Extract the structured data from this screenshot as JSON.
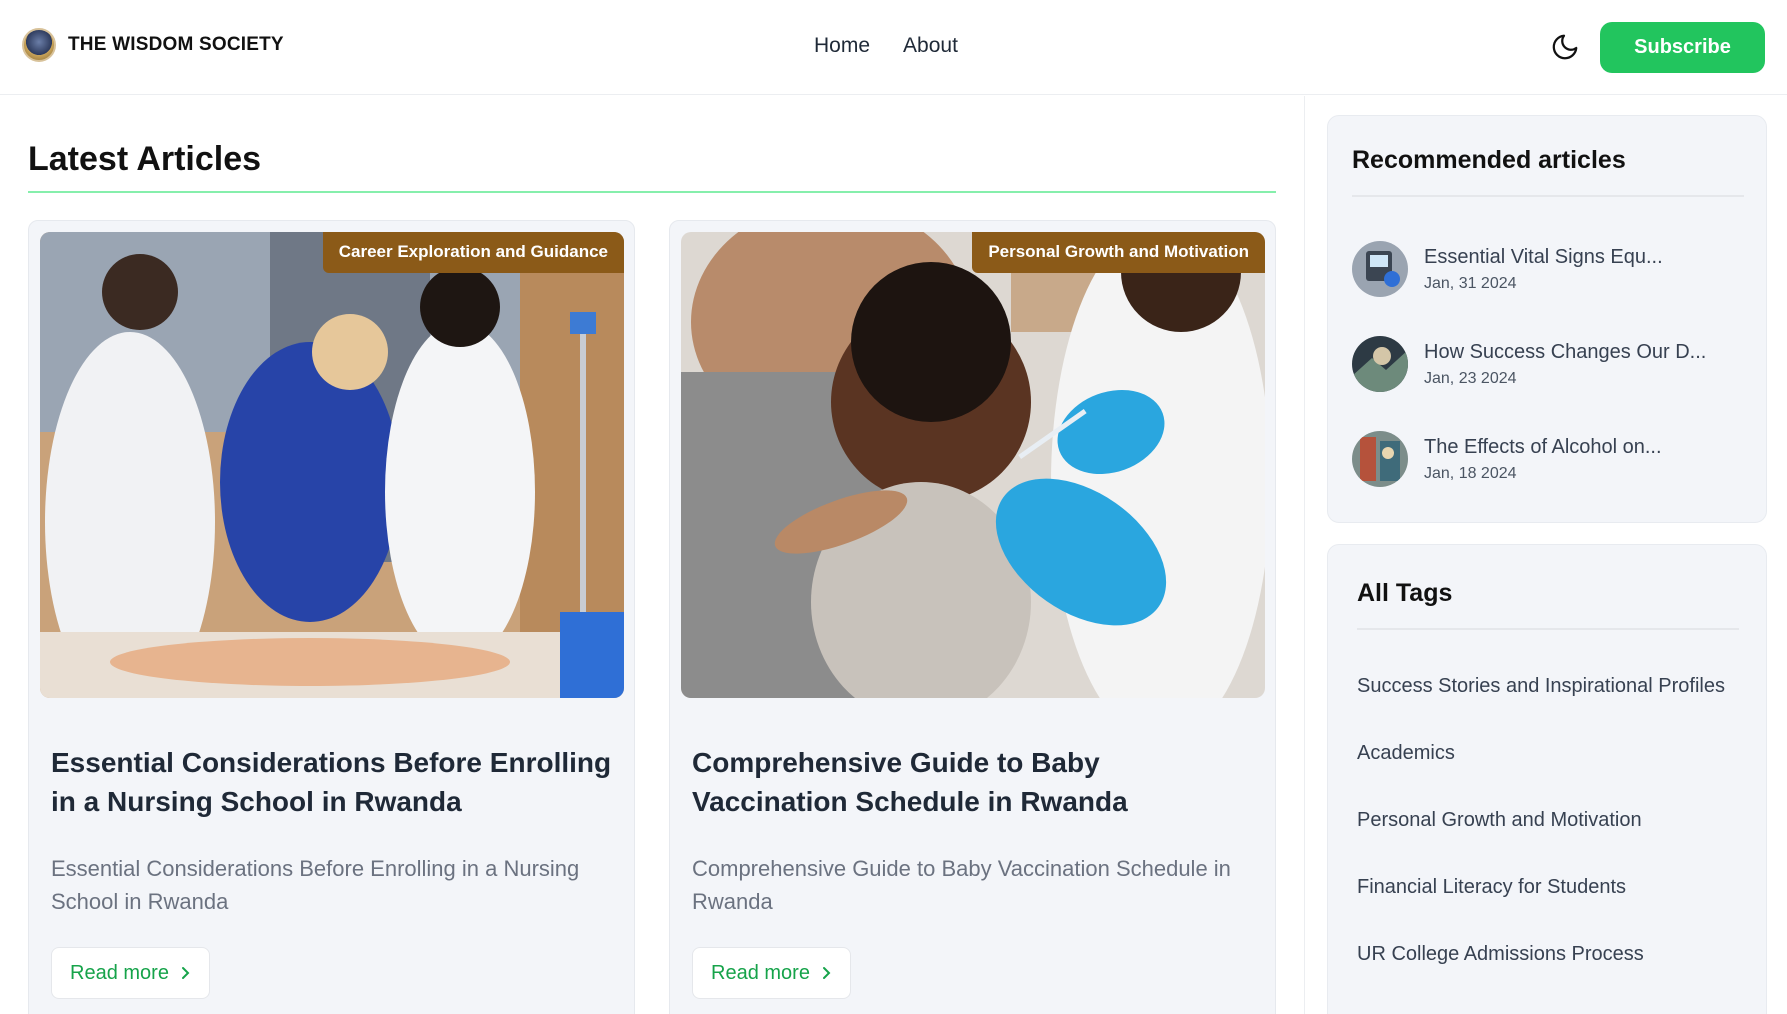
{
  "brand": {
    "name": "THE WISDOM SOCIETY",
    "logo_icon": "society-emblem-icon"
  },
  "nav": {
    "home": "Home",
    "about": "About"
  },
  "header": {
    "theme_icon": "moon-icon",
    "subscribe_label": "Subscribe"
  },
  "colors": {
    "accent": "#22c55e",
    "badge": "#8b5a18",
    "rule": "#86efac",
    "card_bg": "#f3f5f9"
  },
  "main": {
    "title": "Latest Articles",
    "articles": [
      {
        "category": "Career Exploration and Guidance",
        "title": "Essential Considerations Before Enrolling in a Nursing School in Rwanda",
        "description": "Essential Considerations Before Enrolling in a Nursing School in Rwanda",
        "read_more": "Read more"
      },
      {
        "category": "Personal Growth and Motivation",
        "title": "Comprehensive Guide to Baby Vaccination Schedule in Rwanda",
        "description": "Comprehensive Guide to Baby Vaccination Schedule in Rwanda",
        "read_more": "Read more"
      }
    ]
  },
  "sidebar": {
    "recommended": {
      "title": "Recommended articles",
      "items": [
        {
          "title": "Essential Vital Signs Equ...",
          "date": "Jan, 31 2024"
        },
        {
          "title": "How Success Changes Our D...",
          "date": "Jan, 23 2024"
        },
        {
          "title": "The Effects of Alcohol on...",
          "date": "Jan, 18 2024"
        }
      ]
    },
    "tags": {
      "title": "All Tags",
      "items": [
        "Success Stories and Inspirational Profiles",
        "Academics",
        "Personal Growth and Motivation",
        "Financial Literacy for Students",
        "UR College Admissions Process"
      ]
    }
  }
}
